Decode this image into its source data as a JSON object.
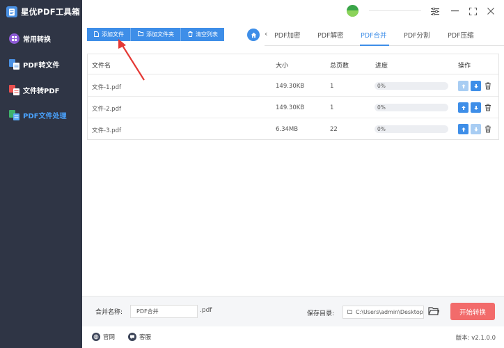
{
  "app": {
    "title": "星优PDF工具箱"
  },
  "sidebar": {
    "items": [
      {
        "label": "常用转换",
        "icon": "common-convert-icon"
      },
      {
        "label": "PDF转文件",
        "icon": "pdf-to-file-icon"
      },
      {
        "label": "文件转PDF",
        "icon": "file-to-pdf-icon"
      },
      {
        "label": "PDF文件处理",
        "icon": "pdf-process-icon",
        "active": true
      }
    ]
  },
  "toolbar": {
    "add_file": "添加文件",
    "add_folder": "添加文件夹",
    "clear_list": "清空列表"
  },
  "tabs": [
    "PDF加密",
    "PDF解密",
    "PDF合并",
    "PDF分割",
    "PDF压缩"
  ],
  "active_tab": "PDF合并",
  "table": {
    "headers": {
      "name": "文件名",
      "size": "大小",
      "pages": "总页数",
      "progress": "进度",
      "actions": "操作"
    },
    "rows": [
      {
        "name": "文件-1.pdf",
        "size": "149.30KB",
        "pages": "1",
        "progress": "0%",
        "progress_value": 0
      },
      {
        "name": "文件-2.pdf",
        "size": "149.30KB",
        "pages": "1",
        "progress": "0%",
        "progress_value": 0
      },
      {
        "name": "文件-3.pdf",
        "size": "6.34MB",
        "pages": "22",
        "progress": "0%",
        "progress_value": 0
      }
    ]
  },
  "bottom": {
    "merge_name_label": "合并名称:",
    "merge_name_value": "PDF合并",
    "extension": ".pdf",
    "save_dir_label": "保存目录:",
    "save_dir_value": "C:\\Users\\admin\\Desktop",
    "start_button": "开始转换"
  },
  "footer": {
    "website": "官网",
    "support": "客服",
    "version": "版本: v2.1.0.0"
  },
  "colors": {
    "accent": "#3e8ee8",
    "sidebar_bg": "#2f3545",
    "start_button": "#f26b6b",
    "annotation_arrow": "#e53935"
  }
}
